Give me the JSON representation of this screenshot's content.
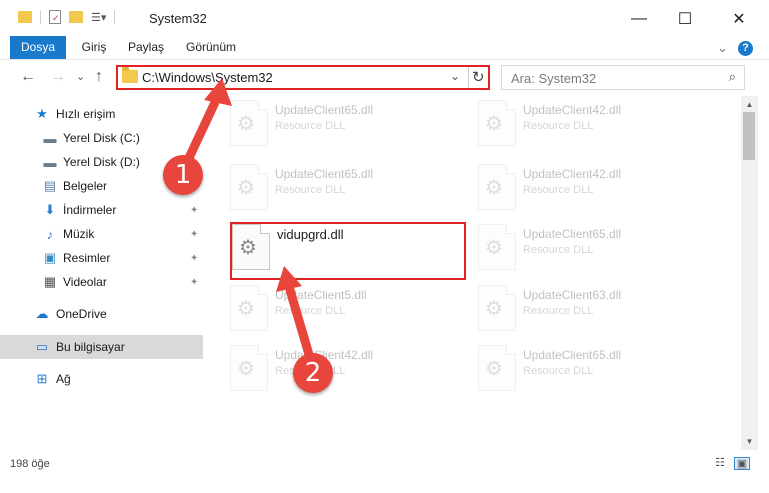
{
  "window": {
    "title": "System32",
    "controls": {
      "minimize": "—",
      "maximize": "☐",
      "close": "✕"
    }
  },
  "ribbon": {
    "tabs": [
      {
        "label": "Dosya",
        "active": true
      },
      {
        "label": "Giriş",
        "active": false
      },
      {
        "label": "Paylaş",
        "active": false
      },
      {
        "label": "Görünüm",
        "active": false
      }
    ],
    "help": "?",
    "expand": "⌄"
  },
  "navigation": {
    "back": "←",
    "forward": "→",
    "recent": "⌄",
    "up": "↑",
    "address": "C:\\Windows\\System32",
    "address_dropdown": "⌄",
    "refresh": "↻",
    "search_placeholder": "Ara: System32",
    "search_icon": "⌕"
  },
  "sidebar": {
    "items": [
      {
        "label": "Hızlı erişim",
        "icon": "star-icon",
        "glyph": "★",
        "color": "#1979ca",
        "pinned": false
      },
      {
        "label": "Yerel Disk (C:)",
        "icon": "drive-icon",
        "glyph": "▬",
        "color": "#6b7d8e",
        "pinned": false
      },
      {
        "label": "Yerel Disk (D:)",
        "icon": "drive-icon",
        "glyph": "▬",
        "color": "#6b7d8e",
        "pinned": false
      },
      {
        "label": "Belgeler",
        "icon": "documents-icon",
        "glyph": "▤",
        "color": "#5a7fa8",
        "pinned": true
      },
      {
        "label": "İndirmeler",
        "icon": "downloads-icon",
        "glyph": "⬇",
        "color": "#2a7ad0",
        "pinned": true
      },
      {
        "label": "Müzik",
        "icon": "music-icon",
        "glyph": "♪",
        "color": "#2a7ad0",
        "pinned": true
      },
      {
        "label": "Resimler",
        "icon": "pictures-icon",
        "glyph": "▣",
        "color": "#3d8cc0",
        "pinned": true
      },
      {
        "label": "Videolar",
        "icon": "videos-icon",
        "glyph": "▦",
        "color": "#555555",
        "pinned": true
      },
      {
        "label": "OneDrive",
        "icon": "cloud-icon",
        "glyph": "☁",
        "color": "#1979ca",
        "pinned": false
      },
      {
        "label": "Bu bilgisayar",
        "icon": "computer-icon",
        "glyph": "▭",
        "color": "#2a7ad0",
        "pinned": false,
        "selected": true
      },
      {
        "label": "Ağ",
        "icon": "network-icon",
        "glyph": "⊞",
        "color": "#2a7ad0",
        "pinned": false
      }
    ],
    "pin_glyph": "📌"
  },
  "files": [
    {
      "name": "UpdateClient65.dll",
      "type": "Resource DLL",
      "faded": true
    },
    {
      "name": "UpdateClient42.dll",
      "type": "Resource DLL",
      "faded": true
    },
    {
      "name": "UpdateClient65.dll",
      "type": "Resource DLL",
      "faded": true
    },
    {
      "name": "UpdateClient42.dll",
      "type": "Resource DLL",
      "faded": true
    },
    {
      "name": "vidupgrd.dll",
      "type": "",
      "faded": false,
      "highlighted": true
    },
    {
      "name": "UpdateClient65.dll",
      "type": "Resource DLL",
      "faded": true
    },
    {
      "name": "UpdateClient5.dll",
      "type": "Resource DLL",
      "faded": true
    },
    {
      "name": "UpdateClient63.dll",
      "type": "Resource DLL",
      "faded": true
    },
    {
      "name": "UpdateClient42.dll",
      "type": "Resource DLL",
      "faded": true
    },
    {
      "name": "UpdateClient65.dll",
      "type": "Resource DLL",
      "faded": true
    }
  ],
  "status": {
    "item_count": "198 öğe"
  },
  "annotations": {
    "marker1": "1",
    "marker2": "2",
    "accent": "#e8453c",
    "highlight": "#e02424"
  },
  "colors": {
    "ribbon_active": "#1979ca",
    "selected_nav": "#d9d9d9"
  }
}
